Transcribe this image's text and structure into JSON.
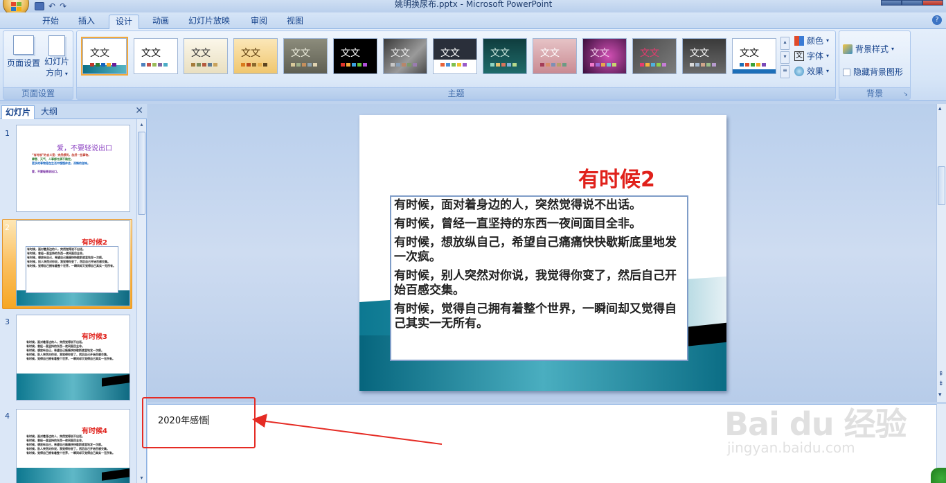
{
  "window": {
    "title": "姚明换尿布.pptx - Microsoft PowerPoint"
  },
  "tabs": [
    "开始",
    "插入",
    "设计",
    "动画",
    "幻灯片放映",
    "审阅",
    "视图"
  ],
  "active_tab": "设计",
  "ribbon": {
    "page_setup_group": {
      "label": "页面设置",
      "page_setup_button": "页面设置",
      "orientation_button_line1": "幻灯片",
      "orientation_button_line2": "方向"
    },
    "themes_group": {
      "label": "主题",
      "theme_sample_text": "文文",
      "colors_button": "颜色",
      "fonts_button": "字体",
      "effects_button": "效果"
    },
    "background_group": {
      "label": "背景",
      "background_styles_button": "背景样式",
      "hide_background_checkbox": "隐藏背景图形"
    }
  },
  "left_pane": {
    "tabs": [
      "幻灯片",
      "大纲"
    ],
    "close_icon": "close-icon",
    "slides": [
      {
        "number": "1",
        "title": "爱，不要轻说出口",
        "lines": [
          "“有时候”的含义是：突然想到，忽然一些事物。",
          "肆意、天气、人事都充满不确定。",
          "更多的事物是在生活中慢慢体会，深情的滋味。",
          "爱，不要轻易说出口。"
        ]
      },
      {
        "number": "2",
        "title": "有时候2",
        "lines": [
          "有时候，面对着身边的人，突然觉得说不出话。",
          "有时候，曾经一直坚持的东西一夜间面目全非。",
          "有时候，想放纵自己，希望自己痛痛快快歇斯底里地发一次疯。",
          "有时候，别人突然对你说，我觉得你变了，然后自己开始百感交集。",
          "有时候，觉得自己拥有着整个世界，一瞬间却又觉得自己其实一无所有。"
        ]
      },
      {
        "number": "3",
        "title": "有时候3",
        "lines": [
          "有时候，面对着身边的人，突然觉得说不出话。",
          "有时候，曾经一直坚持的东西一夜间面目全非。",
          "有时候，想放纵自己，希望自己痛痛快快歇斯底里地发一次疯。",
          "有时候，别人突然对你说，我觉得你变了，然后自己开始百感交集。",
          "有时候，觉得自己拥有着整个世界，一瞬间却又觉得自己其实一无所有。"
        ]
      },
      {
        "number": "4",
        "title": "有时候4",
        "lines": [
          "有时候，面对着身边的人，突然觉得说不出话。",
          "有时候，曾经一直坚持的东西一夜间面目全非。",
          "有时候，想放纵自己，希望自己痛痛快快歇斯底里地发一次疯。",
          "有时候，别人突然对你说，我觉得你变了，然后自己开始百感交集。",
          "有时候，觉得自己拥有着整个世界，一瞬间却又觉得自己其实一无所有。"
        ]
      }
    ]
  },
  "current_slide": {
    "title": "有时候2",
    "paragraphs": [
      "有时候，面对着身边的人，突然觉得说不出话。",
      "有时候，曾经一直坚持的东西一夜间面目全非。",
      "有时候，想放纵自己，希望自己痛痛快快歇斯底里地发一次疯。",
      "有时候，别人突然对你说，我觉得你变了，然后自己开始百感交集。",
      "有时候，觉得自己拥有着整个世界，一瞬间却又觉得自己其实一无所有。"
    ]
  },
  "notes": {
    "text": "2020年感悟"
  },
  "watermark": {
    "brand": "Bai du 经验",
    "url": "jingyan.baidu.com"
  },
  "colors": {
    "accent_red": "#e0211b",
    "annotation_red": "#e52b24",
    "ribbon_blue": "#15428b"
  }
}
